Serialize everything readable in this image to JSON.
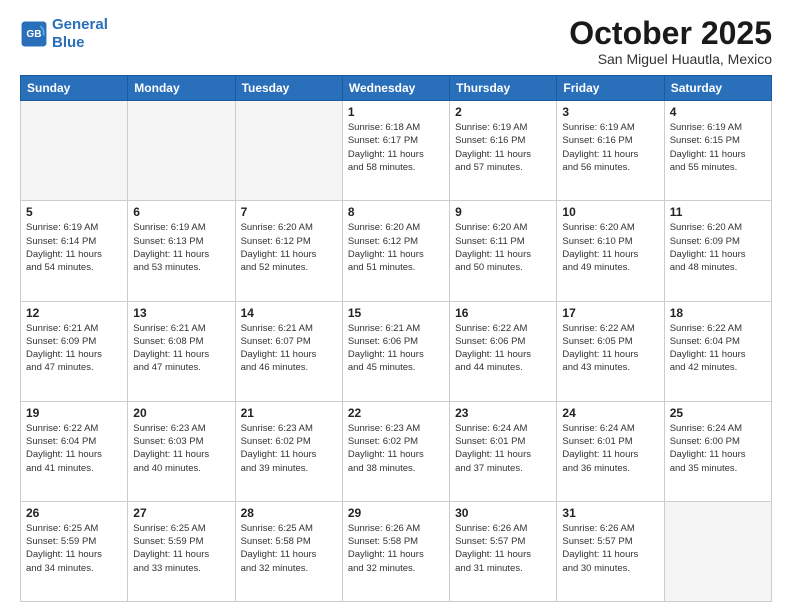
{
  "header": {
    "logo_line1": "General",
    "logo_line2": "Blue",
    "month": "October 2025",
    "location": "San Miguel Huautla, Mexico"
  },
  "days_of_week": [
    "Sunday",
    "Monday",
    "Tuesday",
    "Wednesday",
    "Thursday",
    "Friday",
    "Saturday"
  ],
  "weeks": [
    [
      {
        "day": "",
        "info": ""
      },
      {
        "day": "",
        "info": ""
      },
      {
        "day": "",
        "info": ""
      },
      {
        "day": "1",
        "info": "Sunrise: 6:18 AM\nSunset: 6:17 PM\nDaylight: 11 hours\nand 58 minutes."
      },
      {
        "day": "2",
        "info": "Sunrise: 6:19 AM\nSunset: 6:16 PM\nDaylight: 11 hours\nand 57 minutes."
      },
      {
        "day": "3",
        "info": "Sunrise: 6:19 AM\nSunset: 6:16 PM\nDaylight: 11 hours\nand 56 minutes."
      },
      {
        "day": "4",
        "info": "Sunrise: 6:19 AM\nSunset: 6:15 PM\nDaylight: 11 hours\nand 55 minutes."
      }
    ],
    [
      {
        "day": "5",
        "info": "Sunrise: 6:19 AM\nSunset: 6:14 PM\nDaylight: 11 hours\nand 54 minutes."
      },
      {
        "day": "6",
        "info": "Sunrise: 6:19 AM\nSunset: 6:13 PM\nDaylight: 11 hours\nand 53 minutes."
      },
      {
        "day": "7",
        "info": "Sunrise: 6:20 AM\nSunset: 6:12 PM\nDaylight: 11 hours\nand 52 minutes."
      },
      {
        "day": "8",
        "info": "Sunrise: 6:20 AM\nSunset: 6:12 PM\nDaylight: 11 hours\nand 51 minutes."
      },
      {
        "day": "9",
        "info": "Sunrise: 6:20 AM\nSunset: 6:11 PM\nDaylight: 11 hours\nand 50 minutes."
      },
      {
        "day": "10",
        "info": "Sunrise: 6:20 AM\nSunset: 6:10 PM\nDaylight: 11 hours\nand 49 minutes."
      },
      {
        "day": "11",
        "info": "Sunrise: 6:20 AM\nSunset: 6:09 PM\nDaylight: 11 hours\nand 48 minutes."
      }
    ],
    [
      {
        "day": "12",
        "info": "Sunrise: 6:21 AM\nSunset: 6:09 PM\nDaylight: 11 hours\nand 47 minutes."
      },
      {
        "day": "13",
        "info": "Sunrise: 6:21 AM\nSunset: 6:08 PM\nDaylight: 11 hours\nand 47 minutes."
      },
      {
        "day": "14",
        "info": "Sunrise: 6:21 AM\nSunset: 6:07 PM\nDaylight: 11 hours\nand 46 minutes."
      },
      {
        "day": "15",
        "info": "Sunrise: 6:21 AM\nSunset: 6:06 PM\nDaylight: 11 hours\nand 45 minutes."
      },
      {
        "day": "16",
        "info": "Sunrise: 6:22 AM\nSunset: 6:06 PM\nDaylight: 11 hours\nand 44 minutes."
      },
      {
        "day": "17",
        "info": "Sunrise: 6:22 AM\nSunset: 6:05 PM\nDaylight: 11 hours\nand 43 minutes."
      },
      {
        "day": "18",
        "info": "Sunrise: 6:22 AM\nSunset: 6:04 PM\nDaylight: 11 hours\nand 42 minutes."
      }
    ],
    [
      {
        "day": "19",
        "info": "Sunrise: 6:22 AM\nSunset: 6:04 PM\nDaylight: 11 hours\nand 41 minutes."
      },
      {
        "day": "20",
        "info": "Sunrise: 6:23 AM\nSunset: 6:03 PM\nDaylight: 11 hours\nand 40 minutes."
      },
      {
        "day": "21",
        "info": "Sunrise: 6:23 AM\nSunset: 6:02 PM\nDaylight: 11 hours\nand 39 minutes."
      },
      {
        "day": "22",
        "info": "Sunrise: 6:23 AM\nSunset: 6:02 PM\nDaylight: 11 hours\nand 38 minutes."
      },
      {
        "day": "23",
        "info": "Sunrise: 6:24 AM\nSunset: 6:01 PM\nDaylight: 11 hours\nand 37 minutes."
      },
      {
        "day": "24",
        "info": "Sunrise: 6:24 AM\nSunset: 6:01 PM\nDaylight: 11 hours\nand 36 minutes."
      },
      {
        "day": "25",
        "info": "Sunrise: 6:24 AM\nSunset: 6:00 PM\nDaylight: 11 hours\nand 35 minutes."
      }
    ],
    [
      {
        "day": "26",
        "info": "Sunrise: 6:25 AM\nSunset: 5:59 PM\nDaylight: 11 hours\nand 34 minutes."
      },
      {
        "day": "27",
        "info": "Sunrise: 6:25 AM\nSunset: 5:59 PM\nDaylight: 11 hours\nand 33 minutes."
      },
      {
        "day": "28",
        "info": "Sunrise: 6:25 AM\nSunset: 5:58 PM\nDaylight: 11 hours\nand 32 minutes."
      },
      {
        "day": "29",
        "info": "Sunrise: 6:26 AM\nSunset: 5:58 PM\nDaylight: 11 hours\nand 32 minutes."
      },
      {
        "day": "30",
        "info": "Sunrise: 6:26 AM\nSunset: 5:57 PM\nDaylight: 11 hours\nand 31 minutes."
      },
      {
        "day": "31",
        "info": "Sunrise: 6:26 AM\nSunset: 5:57 PM\nDaylight: 11 hours\nand 30 minutes."
      },
      {
        "day": "",
        "info": ""
      }
    ]
  ]
}
